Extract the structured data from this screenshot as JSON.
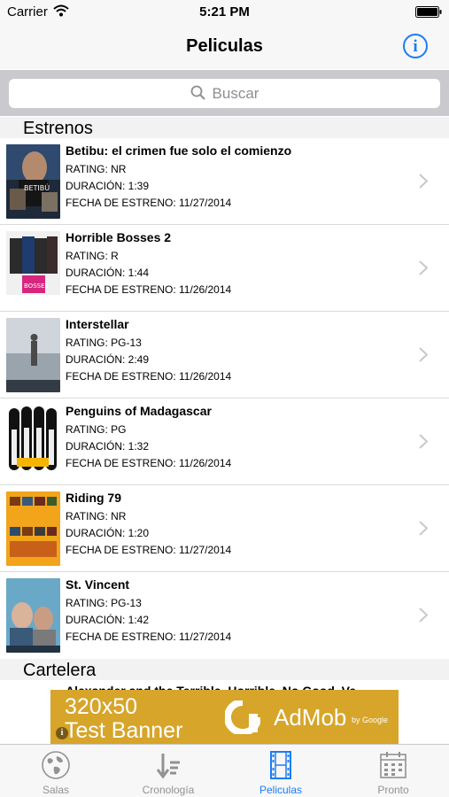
{
  "status_bar": {
    "carrier": "Carrier",
    "time": "5:21 PM"
  },
  "nav": {
    "title": "Peliculas",
    "info_icon": "info-icon",
    "info_glyph": "i"
  },
  "search": {
    "placeholder": "Buscar"
  },
  "sections": [
    {
      "title": "Estrenos",
      "items": [
        {
          "title": "Betibu: el crimen fue solo el comienzo",
          "rating": "RATING: NR",
          "duration": "DURACIÓN: 1:39",
          "release": "FECHA DE ESTRENO: 11/27/2014"
        },
        {
          "title": "Horrible Bosses 2",
          "rating": "RATING: R",
          "duration": "DURACIÓN: 1:44",
          "release": "FECHA DE ESTRENO: 11/26/2014"
        },
        {
          "title": "Interstellar",
          "rating": "RATING: PG-13",
          "duration": "DURACIÓN: 2:49",
          "release": "FECHA DE ESTRENO: 11/26/2014"
        },
        {
          "title": "Penguins of Madagascar",
          "rating": "RATING: PG",
          "duration": "DURACIÓN: 1:32",
          "release": "FECHA DE ESTRENO: 11/26/2014"
        },
        {
          "title": "Riding 79",
          "rating": "RATING: NR",
          "duration": "DURACIÓN: 1:20",
          "release": "FECHA DE ESTRENO: 11/27/2014"
        },
        {
          "title": "St. Vincent",
          "rating": "RATING: PG-13",
          "duration": "DURACIÓN: 1:42",
          "release": "FECHA DE ESTRENO: 11/27/2014"
        }
      ]
    },
    {
      "title": "Cartelera",
      "items": [
        {
          "title": "Alexander and the Terrible, Horrible, No Good, Ve..."
        }
      ]
    }
  ],
  "ad": {
    "line1": "320x50",
    "line2": "Test Banner",
    "brand": "AdMob",
    "by": "by Google",
    "info_glyph": "i",
    "color": "#d6a52a"
  },
  "tabs": [
    {
      "label": "Salas",
      "icon": "globe-icon",
      "active": false
    },
    {
      "label": "Cronología",
      "icon": "sort-icon",
      "active": false
    },
    {
      "label": "Peliculas",
      "icon": "film-icon",
      "active": true
    },
    {
      "label": "Pronto",
      "icon": "calendar-icon",
      "active": false
    }
  ],
  "colors": {
    "accent": "#1a7cf5",
    "section_bg": "#f2f2f2",
    "search_bar_bg": "#c9c9ce"
  }
}
